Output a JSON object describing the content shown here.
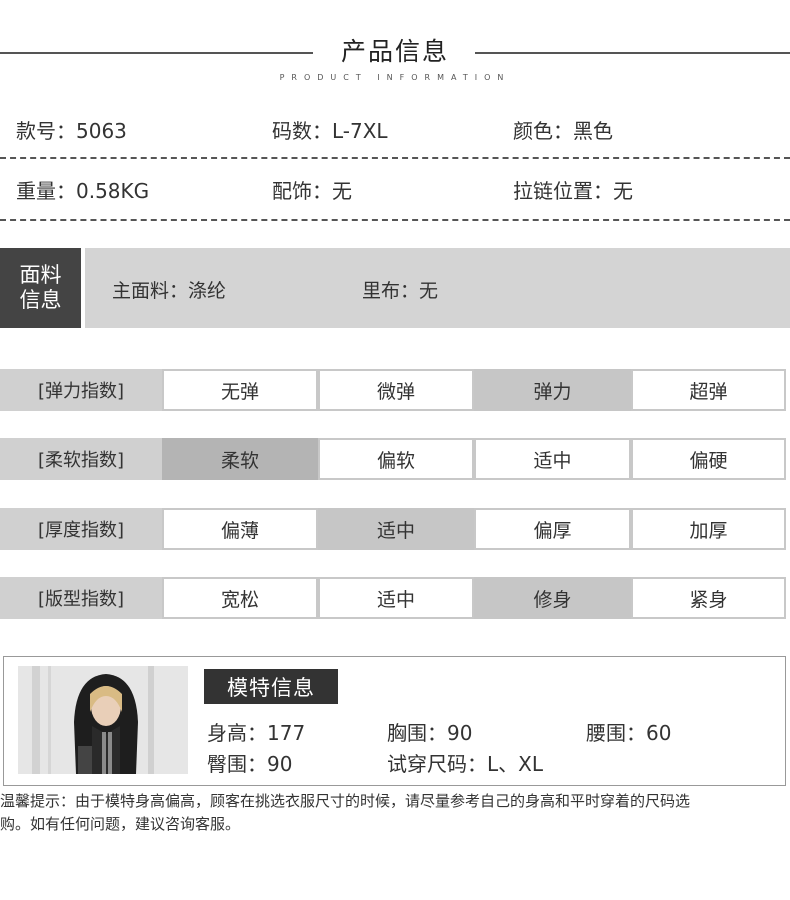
{
  "section_header": {
    "title": "产品信息",
    "subtitle": "PRODUCT  INFORMATION"
  },
  "basic_info": {
    "row1": [
      "款号：5063",
      "码数：L-7XL",
      "颜色：黑色"
    ],
    "row2": [
      "重量：0.58KG",
      "配饰：无",
      "拉链位置：无"
    ]
  },
  "fabric": {
    "label": "面料信息",
    "main": "主面料：涤纶",
    "lining": "里布：无"
  },
  "indices": [
    {
      "label": "[弹力指数]",
      "options": [
        "无弹",
        "微弹",
        "弹力",
        "超弹"
      ],
      "selected": 2
    },
    {
      "label": "[柔软指数]",
      "options": [
        "柔软",
        "偏软",
        "适中",
        "偏硬"
      ],
      "selected": 0
    },
    {
      "label": "[厚度指数]",
      "options": [
        "偏薄",
        "适中",
        "偏厚",
        "加厚"
      ],
      "selected": 1
    },
    {
      "label": "[版型指数]",
      "options": [
        "宽松",
        "适中",
        "修身",
        "紧身"
      ],
      "selected": 2
    }
  ],
  "model": {
    "badge": "模特信息",
    "height": "身高：177",
    "bust": "胸围：90",
    "waist": "腰围：60",
    "hip": "臀围：90",
    "size": "试穿尺码：L、XL"
  },
  "note": {
    "line1": "温馨提示：由于模特身高偏高，顾客在挑选衣服尺寸的时候，请尽量参考自己的身高和平时穿着的尺码选",
    "line2": "购。如有任何问题，建议咨询客服。"
  },
  "colors": {
    "dark_label": "#444444",
    "band_gray": "#d4d4d4",
    "selected_gray": "#c6c6c6"
  }
}
